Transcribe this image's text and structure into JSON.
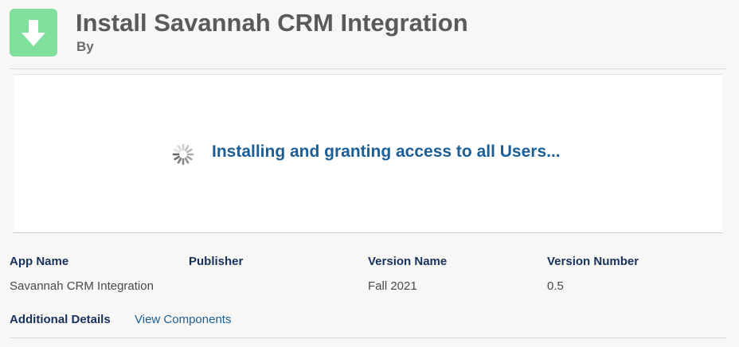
{
  "header": {
    "icon": "download-arrow-icon",
    "icon_color": "#7fe09c",
    "title": "Install Savannah CRM Integration",
    "by_label": "By"
  },
  "status": {
    "icon": "loading-spinner-icon",
    "message": "Installing and granting access to all Users...",
    "color": "#1b5f96"
  },
  "details": {
    "columns": [
      {
        "header": "App Name",
        "value": "Savannah CRM Integration"
      },
      {
        "header": "Publisher",
        "value": ""
      },
      {
        "header": "Version Name",
        "value": "Fall 2021"
      },
      {
        "header": "Version Number",
        "value": "0.5"
      }
    ],
    "additional_label": "Additional Details",
    "view_components_link": "View Components"
  },
  "colors": {
    "heading": "#16325c",
    "link": "#1b5f96",
    "page_bg": "#f8f7f5"
  }
}
